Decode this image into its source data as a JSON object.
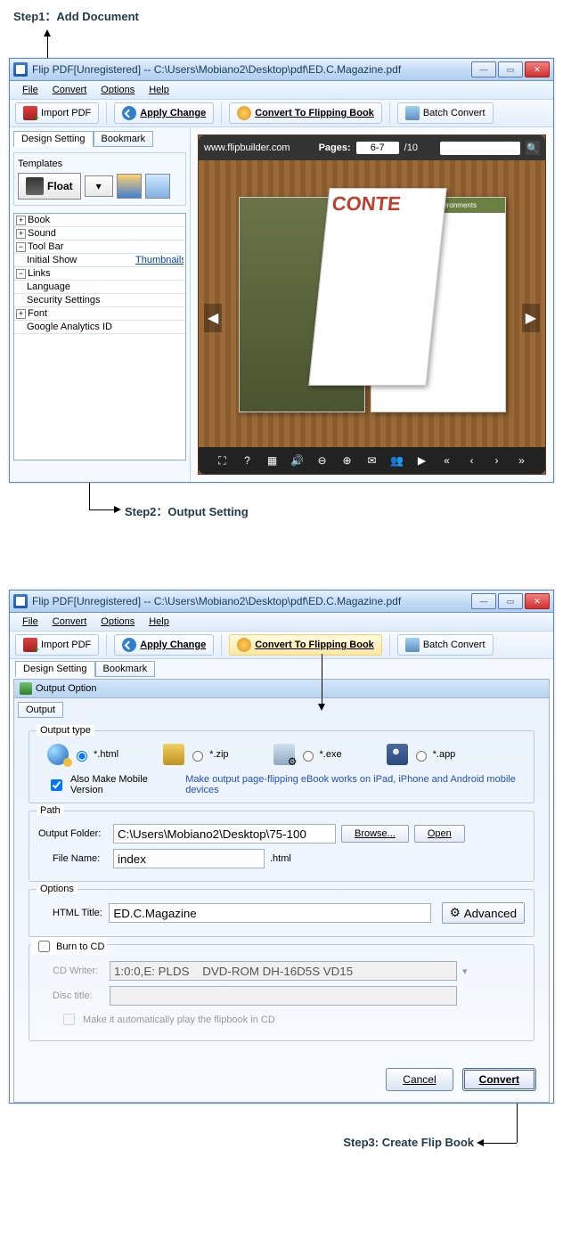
{
  "steps": {
    "s1": "Step1：Add Document",
    "s2": "Step2：Output Setting",
    "s3": "Step3: Create Flip Book"
  },
  "win": {
    "title": "Flip PDF[Unregistered] -- C:\\Users\\Mobiano2\\Desktop\\pdf\\ED.C.Magazine.pdf",
    "menu": {
      "file": "File",
      "convert": "Convert",
      "options": "Options",
      "help": "Help"
    },
    "tb": {
      "import": "Import PDF",
      "apply": "Apply Change",
      "convert": "Convert To Flipping Book",
      "batch": "Batch Convert"
    }
  },
  "left": {
    "tab1": "Design Setting",
    "tab2": "Bookmark",
    "templates": "Templates",
    "float": "Float",
    "tree": {
      "book": "Book",
      "sound": "Sound",
      "toolbar": "Tool Bar",
      "initialShow": "Initial Show",
      "initialShowVal": "Thumbnails",
      "links": "Links",
      "language": "Language",
      "security": "Security Settings",
      "font": "Font",
      "ga": "Google Analytics ID"
    }
  },
  "preview": {
    "url": "www.flipbuilder.com",
    "pagesLbl": "Pages:",
    "pageCur": "6-7",
    "pageTotal": "/10",
    "conte": "CONTE",
    "hdr": "st Effective Green Environments"
  },
  "out": {
    "dialogTitle": "Output Option",
    "tab": "Output",
    "typeLegend": "Output type",
    "html": "*.html",
    "zip": "*.zip",
    "exe": "*.exe",
    "app": "*.app",
    "mobile": "Also Make Mobile Version",
    "mobileNote": "Make output page-flipping eBook works on iPad, iPhone and Android mobile devices",
    "pathLegend": "Path",
    "outputFolderLbl": "Output Folder:",
    "outputFolderVal": "C:\\Users\\Mobiano2\\Desktop\\75-100",
    "browse": "Browse...",
    "open": "Open",
    "fileNameLbl": "File Name:",
    "fileNameVal": "index",
    "ext": ".html",
    "optionsLegend": "Options",
    "htmlTitleLbl": "HTML Title:",
    "htmlTitleVal": "ED.C.Magazine",
    "advanced": "Advanced",
    "burnLegend": "Burn to CD",
    "cdWriterLbl": "CD Writer:",
    "cdWriterVal": "1:0:0,E: PLDS    DVD-ROM DH-16D5S VD15",
    "discTitleLbl": "Disc title:",
    "autoPlay": "Make it automatically play the flipbook in CD",
    "cancel": "Cancel",
    "convert": "Convert"
  }
}
